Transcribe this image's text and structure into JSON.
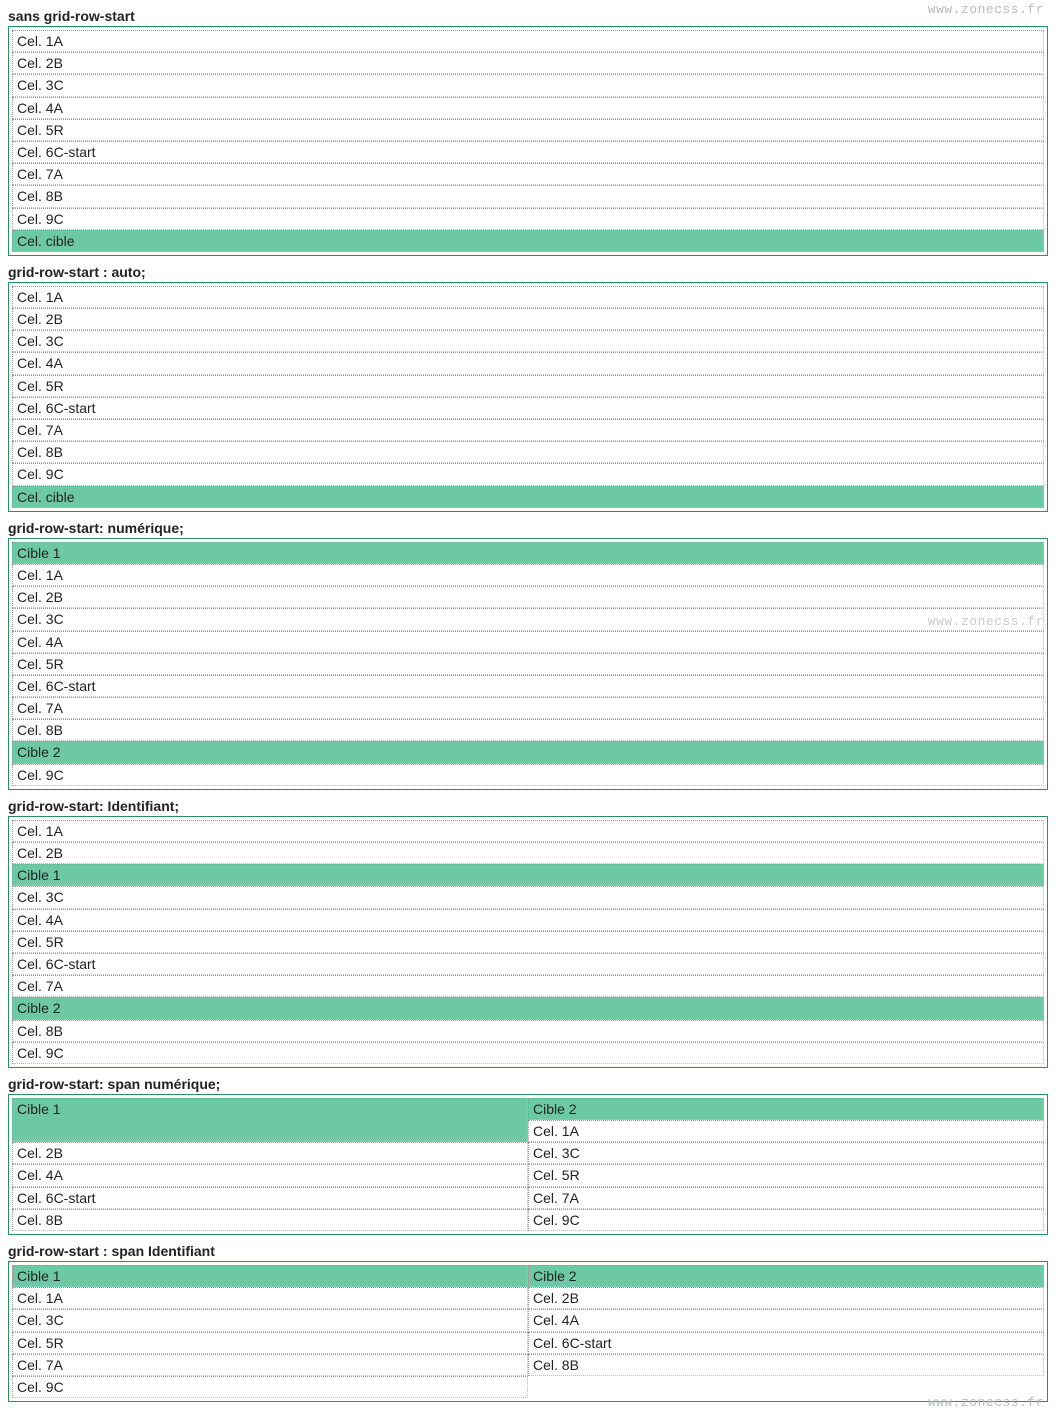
{
  "watermarks": {
    "top": "www.zonecss.fr",
    "mid": "www.zonecss.fr",
    "bottom": "www.zonecss.fr"
  },
  "sections": [
    {
      "title": "sans grid-row-start",
      "layout": "1col",
      "cells": [
        {
          "label": "Cel. 1A",
          "target": false
        },
        {
          "label": "Cel. 2B",
          "target": false
        },
        {
          "label": "Cel. 3C",
          "target": false
        },
        {
          "label": "Cel. 4A",
          "target": false
        },
        {
          "label": "Cel. 5R",
          "target": false
        },
        {
          "label": "Cel. 6C-start",
          "target": false
        },
        {
          "label": "Cel. 7A",
          "target": false
        },
        {
          "label": "Cel. 8B",
          "target": false
        },
        {
          "label": "Cel. 9C",
          "target": false
        },
        {
          "label": "Cel. cible",
          "target": true
        }
      ]
    },
    {
      "title": "grid-row-start : auto;",
      "layout": "1col",
      "cells": [
        {
          "label": "Cel. 1A",
          "target": false
        },
        {
          "label": "Cel. 2B",
          "target": false
        },
        {
          "label": "Cel. 3C",
          "target": false
        },
        {
          "label": "Cel. 4A",
          "target": false
        },
        {
          "label": "Cel. 5R",
          "target": false
        },
        {
          "label": "Cel. 6C-start",
          "target": false
        },
        {
          "label": "Cel. 7A",
          "target": false
        },
        {
          "label": "Cel. 8B",
          "target": false
        },
        {
          "label": "Cel. 9C",
          "target": false
        },
        {
          "label": "Cel. cible",
          "target": true
        }
      ]
    },
    {
      "title": "grid-row-start: numérique;",
      "layout": "1col",
      "cells": [
        {
          "label": "Cible 1",
          "target": true
        },
        {
          "label": "Cel. 1A",
          "target": false
        },
        {
          "label": "Cel. 2B",
          "target": false
        },
        {
          "label": "Cel. 3C",
          "target": false
        },
        {
          "label": "Cel. 4A",
          "target": false
        },
        {
          "label": "Cel. 5R",
          "target": false
        },
        {
          "label": "Cel. 6C-start",
          "target": false
        },
        {
          "label": "Cel. 7A",
          "target": false
        },
        {
          "label": "Cel. 8B",
          "target": false
        },
        {
          "label": "Cible 2",
          "target": true
        },
        {
          "label": "Cel. 9C",
          "target": false
        }
      ]
    },
    {
      "title": "grid-row-start: Identifiant;",
      "layout": "1col",
      "cells": [
        {
          "label": "Cel. 1A",
          "target": false
        },
        {
          "label": "Cel. 2B",
          "target": false
        },
        {
          "label": "Cible 1",
          "target": true
        },
        {
          "label": "Cel. 3C",
          "target": false
        },
        {
          "label": "Cel. 4A",
          "target": false
        },
        {
          "label": "Cel. 5R",
          "target": false
        },
        {
          "label": "Cel. 6C-start",
          "target": false
        },
        {
          "label": "Cel. 7A",
          "target": false
        },
        {
          "label": "Cible 2",
          "target": true
        },
        {
          "label": "Cel. 8B",
          "target": false
        },
        {
          "label": "Cel. 9C",
          "target": false
        }
      ]
    },
    {
      "title": "grid-row-start: span numérique;",
      "layout": "2col",
      "cells": [
        {
          "label": "Cible 1",
          "target": true,
          "rowspan": 2
        },
        {
          "label": "Cible 2",
          "target": true
        },
        {
          "label": "Cel. 1A",
          "target": false
        },
        {
          "label": "Cel. 2B",
          "target": false
        },
        {
          "label": "Cel. 3C",
          "target": false
        },
        {
          "label": "Cel. 4A",
          "target": false
        },
        {
          "label": "Cel. 5R",
          "target": false
        },
        {
          "label": "Cel. 6C-start",
          "target": false
        },
        {
          "label": "Cel. 7A",
          "target": false
        },
        {
          "label": "Cel. 8B",
          "target": false
        },
        {
          "label": "Cel. 9C",
          "target": false
        }
      ]
    },
    {
      "title": "grid-row-start : span Identifiant",
      "layout": "2col",
      "cells": [
        {
          "label": "Cible 1",
          "target": true
        },
        {
          "label": "Cible 2",
          "target": true
        },
        {
          "label": "Cel. 1A",
          "target": false
        },
        {
          "label": "Cel. 2B",
          "target": false
        },
        {
          "label": "Cel. 3C",
          "target": false
        },
        {
          "label": "Cel. 4A",
          "target": false
        },
        {
          "label": "Cel. 5R",
          "target": false
        },
        {
          "label": "Cel. 6C-start",
          "target": false
        },
        {
          "label": "Cel. 7A",
          "target": false
        },
        {
          "label": "Cel. 8B",
          "target": false
        },
        {
          "label": "Cel. 9C",
          "target": false
        }
      ]
    }
  ]
}
